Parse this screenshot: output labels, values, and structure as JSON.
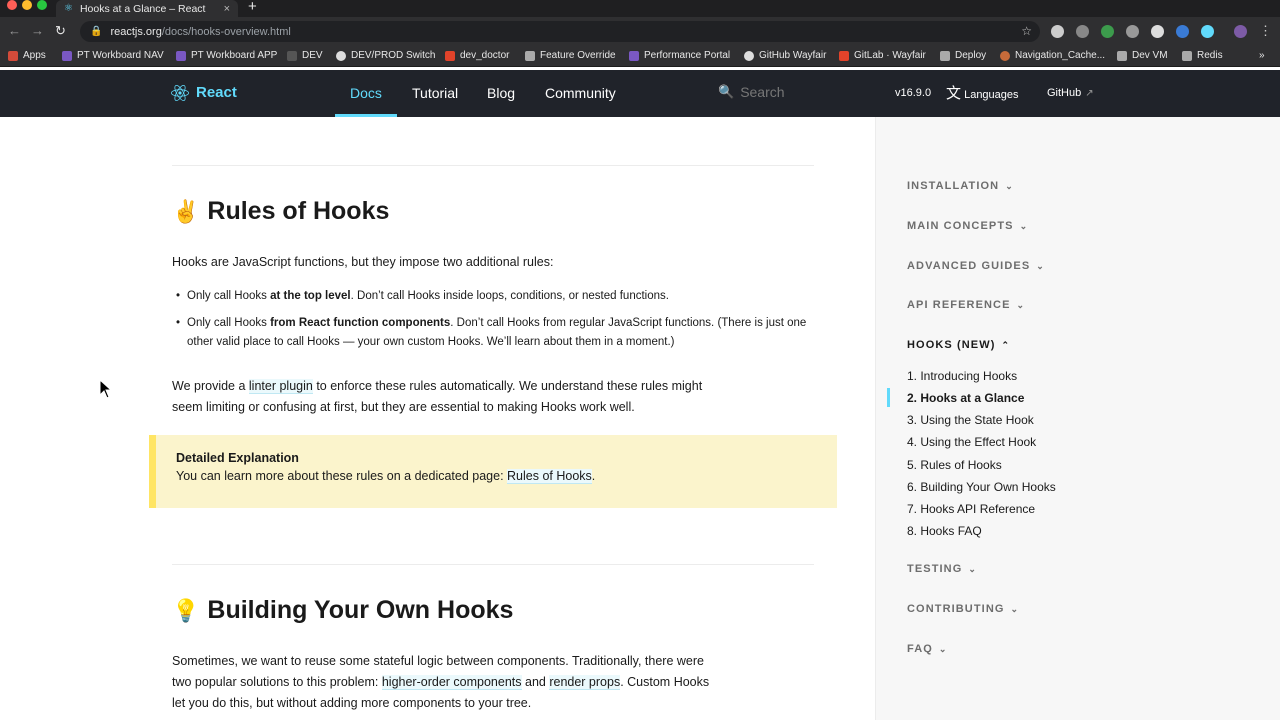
{
  "browser": {
    "tab_title": "Hooks at a Glance – React",
    "tab_close": "×",
    "new_tab": "+",
    "url_host": "reactjs.org",
    "url_path": "/docs/hooks-overview.html",
    "bookmarks": [
      "Apps",
      "PT Workboard NAV",
      "PT Workboard APP",
      "DEV",
      "DEV/PROD Switch",
      "dev_doctor",
      "Feature Override",
      "Performance Portal",
      "GitHub Wayfair",
      "GitLab · Wayfair",
      "Deploy",
      "Navigation_Cache...",
      "Dev VM",
      "Redis"
    ],
    "colors": {
      "close": "#ff5f57",
      "minimize": "#febc2e",
      "zoom": "#28c840"
    }
  },
  "header": {
    "logo_text": "React",
    "nav": [
      "Docs",
      "Tutorial",
      "Blog",
      "Community"
    ],
    "search_placeholder": "Search",
    "version": "v16.9.0",
    "languages": "Languages",
    "github": "GitHub",
    "accent": "#61dafb"
  },
  "main": {
    "rules_title": "Rules of Hooks",
    "rules_emoji": "✌️",
    "rules_intro": "Hooks are JavaScript functions, but they impose two additional rules:",
    "rule1_pre": "Only call Hooks ",
    "rule1_bold": "at the top level",
    "rule1_post": ". Don’t call Hooks inside loops, conditions, or nested functions.",
    "rule2_pre": "Only call Hooks ",
    "rule2_bold": "from React function components",
    "rule2_post": ". Don’t call Hooks from regular JavaScript functions. (There is just one other valid place to call Hooks — your own custom Hooks. We’ll learn about them in a moment.)",
    "lint_pre": "We provide a ",
    "lint_link": "linter plugin",
    "lint_post": " to enforce these rules automatically. We understand these rules might seem limiting or confusing at first, but they are essential to making Hooks work well.",
    "callout_title": "Detailed Explanation",
    "callout_pre": "You can learn more about these rules on a dedicated page: ",
    "callout_link": "Rules of Hooks",
    "callout_post": ".",
    "building_title": "Building Your Own Hooks",
    "building_emoji": "💡",
    "build_pre": "Sometimes, we want to reuse some stateful logic between components. Traditionally, there were two popular solutions to this problem: ",
    "build_link1": "higher-order components",
    "build_mid": " and ",
    "build_link2": "render props",
    "build_post": ". Custom Hooks let you do this, but without adding more components to your tree."
  },
  "sidebar": {
    "sections": [
      "INSTALLATION",
      "MAIN CONCEPTS",
      "ADVANCED GUIDES",
      "API REFERENCE",
      "HOOKS (NEW)",
      "TESTING",
      "CONTRIBUTING",
      "FAQ"
    ],
    "hooks_items": [
      "1. Introducing Hooks",
      "2. Hooks at a Glance",
      "3. Using the State Hook",
      "4. Using the Effect Hook",
      "5. Rules of Hooks",
      "6. Building Your Own Hooks",
      "7. Hooks API Reference",
      "8. Hooks FAQ"
    ]
  }
}
